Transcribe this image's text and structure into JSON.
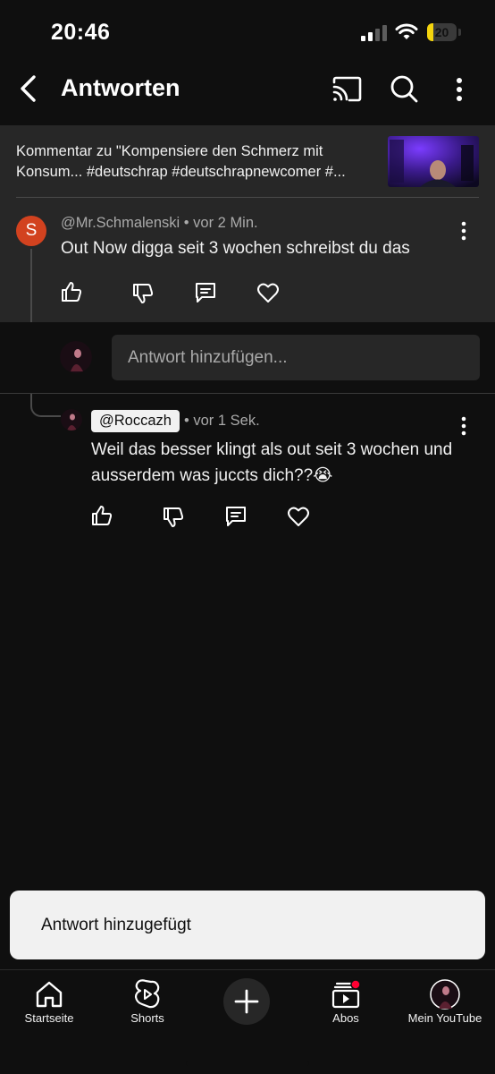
{
  "status_bar": {
    "time": "20:46",
    "battery_level": "20",
    "battery_fraction": 0.2,
    "battery_color": "#f4d40d",
    "icons": [
      "signal-icon",
      "wifi-icon",
      "battery-icon"
    ]
  },
  "header": {
    "title": "Antworten",
    "icons": [
      "back-arrow-icon",
      "cast-icon",
      "search-icon",
      "more-vert-icon"
    ]
  },
  "video_context": {
    "text": "Kommentar zu \"Kompensiere den Schmerz mit Konsum... #deutschrap #deutschrapnewcomer #..."
  },
  "parent_comment": {
    "avatar_letter": "S",
    "avatar_color": "#d2421f",
    "author": "@Mr.Schmalenski",
    "time": "vor 2 Min.",
    "text": "Out Now digga seit 3 wochen schreibst du das",
    "actions": [
      "thumb-up-icon",
      "thumb-down-icon",
      "reply-icon",
      "heart-icon"
    ]
  },
  "reply_input": {
    "placeholder": "Antwort hinzufügen..."
  },
  "reply": {
    "author": "@Roccazh",
    "time": "vor 1 Sek.",
    "text": "Weil das besser klingt als out seit 3 wochen und ausserdem was juccts dich??😭",
    "actions": [
      "thumb-up-icon",
      "thumb-down-icon",
      "reply-icon",
      "heart-icon"
    ]
  },
  "toast": {
    "text": "Antwort hinzugefügt"
  },
  "bottom_nav": {
    "items": [
      {
        "label": "Startseite",
        "icon": "home-icon"
      },
      {
        "label": "Shorts",
        "icon": "shorts-icon"
      },
      {
        "label": "",
        "icon": "create-plus-icon"
      },
      {
        "label": "Abos",
        "icon": "subscriptions-icon"
      },
      {
        "label": "Mein YouTube",
        "icon": "profile-avatar"
      }
    ],
    "notification_dot_color": "#ff0033"
  },
  "colors": {
    "background": "#0f0f0f",
    "surface": "#272727",
    "text_primary": "#f1f1f1",
    "text_secondary": "#aaaaaa"
  }
}
